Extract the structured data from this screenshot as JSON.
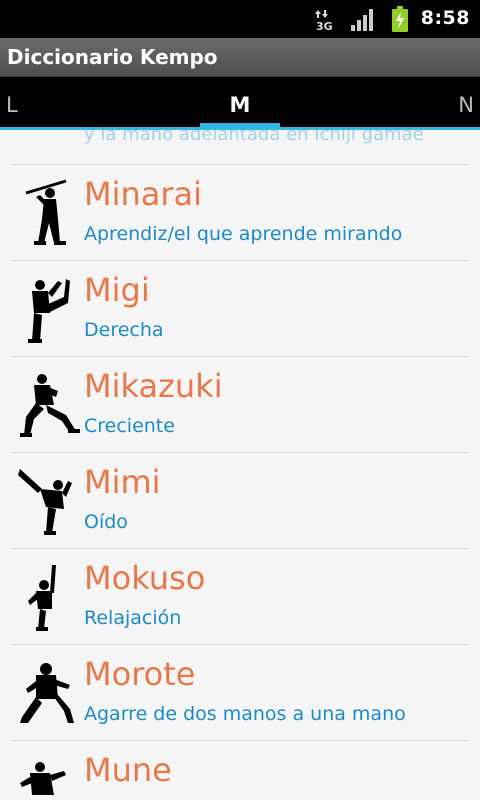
{
  "status_bar": {
    "network": "3G",
    "time": "8:58",
    "icons": [
      "data-arrows-icon",
      "signal-icon",
      "battery-charging-icon"
    ]
  },
  "app": {
    "title": "Diccionario Kempo"
  },
  "tabs": {
    "prev": "L",
    "current": "M",
    "next": "N"
  },
  "list": {
    "partial_text": "y la mano adelantada en Ichiji gamae",
    "items": [
      {
        "term": "Minarai",
        "definition": "Aprendiz/el que aprende mirando",
        "icon": "karate-stance-staff-icon"
      },
      {
        "term": "Migi",
        "definition": "Derecha",
        "icon": "karate-knee-raise-icon"
      },
      {
        "term": "Mikazuki",
        "definition": "Creciente",
        "icon": "karate-crouch-kick-icon"
      },
      {
        "term": "Mimi",
        "definition": "Oído",
        "icon": "karate-high-kick-icon"
      },
      {
        "term": "Mokuso",
        "definition": "Relajación",
        "icon": "karate-vertical-kick-icon"
      },
      {
        "term": "Morote",
        "definition": "Agarre de dos manos a una mano",
        "icon": "karate-low-stance-icon"
      },
      {
        "term": "Mune",
        "definition": "",
        "icon": "karate-fighter-icon"
      }
    ]
  },
  "colors": {
    "accent": "#33b5e5",
    "term": "#e8784a",
    "definition": "#1d8ac8"
  }
}
